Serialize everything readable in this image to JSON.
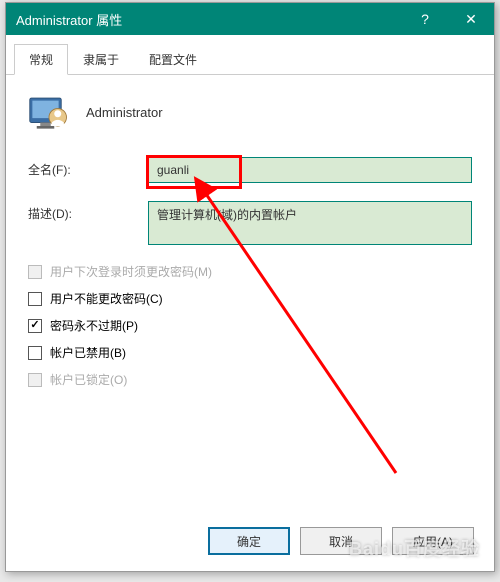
{
  "window": {
    "title": "Administrator 属性",
    "help": "?",
    "close": "✕"
  },
  "tabs": {
    "general": "常规",
    "member_of": "隶属于",
    "profile": "配置文件"
  },
  "user": {
    "name": "Administrator"
  },
  "form": {
    "fullname_label": "全名(F):",
    "fullname_value": "guanli",
    "desc_label": "描述(D):",
    "desc_value": "管理计算机(域)的内置帐户"
  },
  "checkboxes": {
    "must_change": "用户下次登录时须更改密码(M)",
    "cannot_change": "用户不能更改密码(C)",
    "never_expire": "密码永不过期(P)",
    "disabled": "帐户已禁用(B)",
    "locked": "帐户已锁定(O)"
  },
  "buttons": {
    "ok": "确定",
    "cancel": "取消",
    "apply": "应用(A)"
  },
  "watermark": "Baidu百度经验"
}
